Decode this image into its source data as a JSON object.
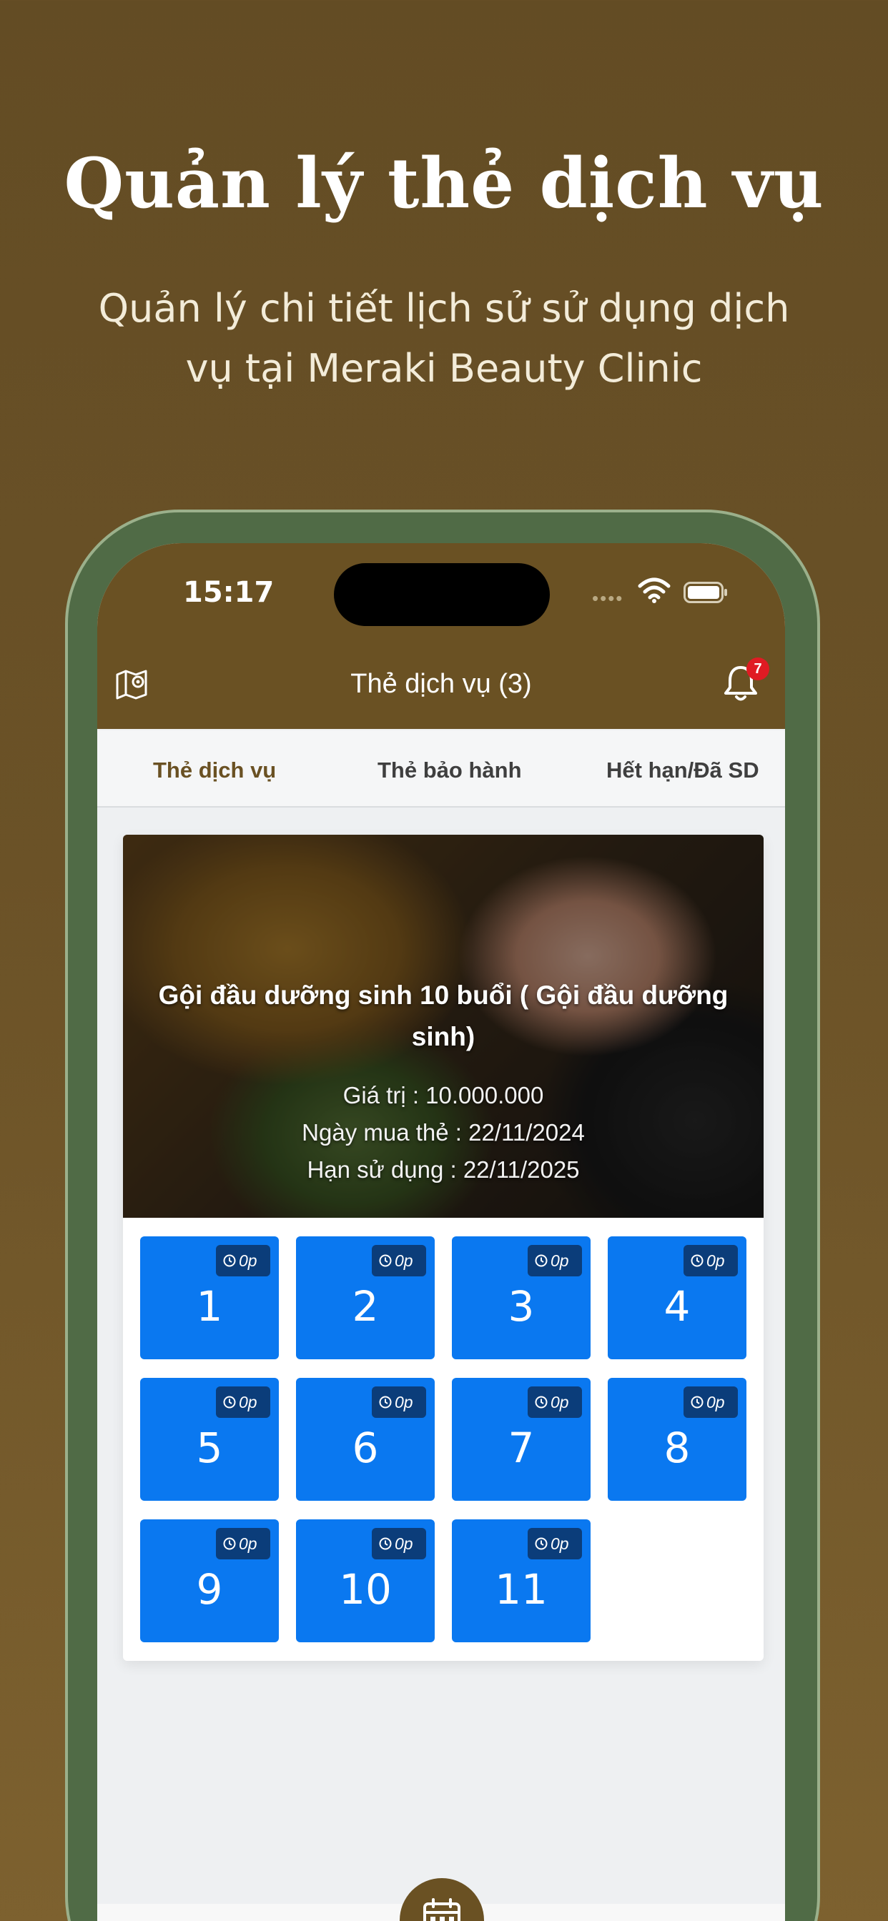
{
  "promo": {
    "title": "Quản lý thẻ dịch vụ",
    "subtitle": "Quản lý chi tiết lịch sử sử dụng dịch vụ tại Meraki Beauty Clinic"
  },
  "status_bar": {
    "time": "15:17",
    "signal": "••••"
  },
  "header": {
    "title": "Thẻ dịch vụ (3)",
    "notification_count": "7",
    "left_icon": "map-pin-icon",
    "right_icon": "bell-icon"
  },
  "tabs": [
    {
      "label": "Thẻ dịch vụ",
      "active": true
    },
    {
      "label": "Thẻ bảo hành",
      "active": false
    },
    {
      "label": "Hết hạn/Đã SD",
      "active": false
    }
  ],
  "card": {
    "title": "Gội đầu dưỡng sinh 10 buổi ( Gội đầu dưỡng sinh)",
    "value_line": "Giá trị : 10.000.000",
    "bought_line": "Ngày mua thẻ : 22/11/2024",
    "expiry_line": "Hạn sử dụng : 22/11/2025"
  },
  "sessions": [
    {
      "number": "1",
      "duration": "0p"
    },
    {
      "number": "2",
      "duration": "0p"
    },
    {
      "number": "3",
      "duration": "0p"
    },
    {
      "number": "4",
      "duration": "0p"
    },
    {
      "number": "5",
      "duration": "0p"
    },
    {
      "number": "6",
      "duration": "0p"
    },
    {
      "number": "7",
      "duration": "0p"
    },
    {
      "number": "8",
      "duration": "0p"
    },
    {
      "number": "9",
      "duration": "0p"
    },
    {
      "number": "10",
      "duration": "0p"
    },
    {
      "number": "11",
      "duration": "0p"
    }
  ],
  "colors": {
    "brand": "#6a5123",
    "session_tile": "#0a78f0",
    "session_chip": "#0b3d7a",
    "badge": "#e01b23",
    "phone_frame": "#506b46"
  },
  "bottom": {
    "fab_icon": "calendar-icon"
  }
}
